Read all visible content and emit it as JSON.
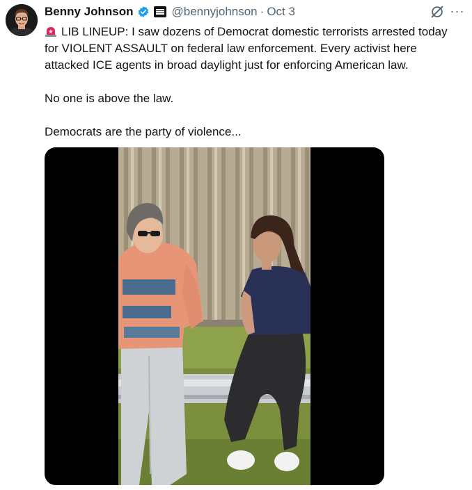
{
  "tweet": {
    "author_name": "Benny Johnson",
    "handle": "@bennyjohnson",
    "separator": "·",
    "date": "Oct 3",
    "more_label": "···",
    "paragraphs": [
      "LIB LINEUP: I saw dozens of Democrat domestic terrorists arrested today for VIOLENT ASSAULT on federal law enforcement. Every activist here attacked ICE agents in broad daylight just for enforcing American law.",
      "No one is above the law.",
      "Democrats are the party of violence..."
    ]
  },
  "icons": {
    "verified": "verified-badge-icon",
    "affiliate": "affiliate-badge-icon",
    "siren": "police-siren-emoji",
    "grok": "grok-icon",
    "more": "more-options-icon"
  },
  "colors": {
    "verified": "#1d9bf0",
    "secondary_text": "#536471",
    "siren": "#e0245e"
  }
}
